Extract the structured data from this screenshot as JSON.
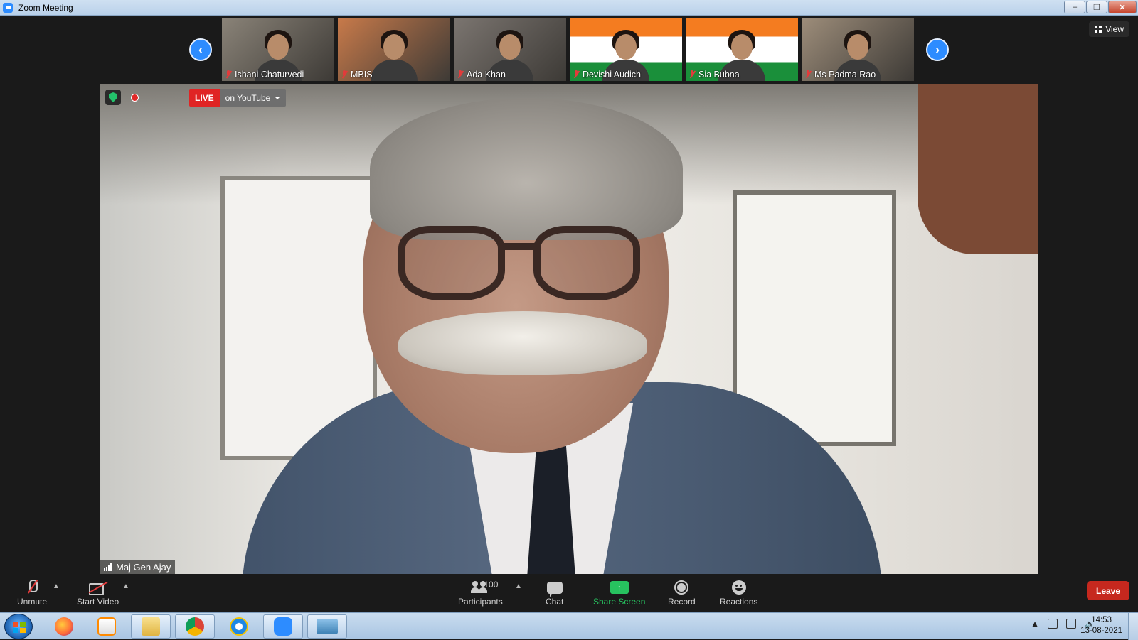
{
  "window": {
    "title": "Zoom Meeting"
  },
  "gallery": {
    "participants": [
      {
        "name": "Ishani Chaturvedi",
        "bg": "#8a8378",
        "muted": true
      },
      {
        "name": "MBIS",
        "bg": "#c87a4a",
        "muted": true
      },
      {
        "name": "Ada Khan",
        "bg": "#7b7570",
        "muted": true
      },
      {
        "name": "Devishi Audich",
        "bg": "flag",
        "muted": true
      },
      {
        "name": "Sia Bubna",
        "bg": "flag",
        "muted": true
      },
      {
        "name": "Ms Padma Rao",
        "bg": "#9d8d7a",
        "muted": true
      }
    ],
    "view_label": "View"
  },
  "main": {
    "live_label": "LIVE",
    "live_platform": "on YouTube",
    "speaker_name": "Maj Gen Ajay"
  },
  "toolbar": {
    "unmute": "Unmute",
    "start_video": "Start Video",
    "participants": "Participants",
    "participants_count": "100",
    "chat": "Chat",
    "share_screen": "Share Screen",
    "record": "Record",
    "reactions": "Reactions",
    "leave": "Leave"
  },
  "taskbar": {
    "apps": [
      "firefox",
      "media-player",
      "file-explorer",
      "chrome",
      "internet-explorer",
      "zoom",
      "photo-viewer"
    ],
    "time": "14:53",
    "date": "13-08-2021"
  },
  "colors": {
    "zoom_blue": "#2d8cff",
    "live_red": "#e02424",
    "share_green": "#27c25f",
    "leave_red": "#c6281e"
  }
}
